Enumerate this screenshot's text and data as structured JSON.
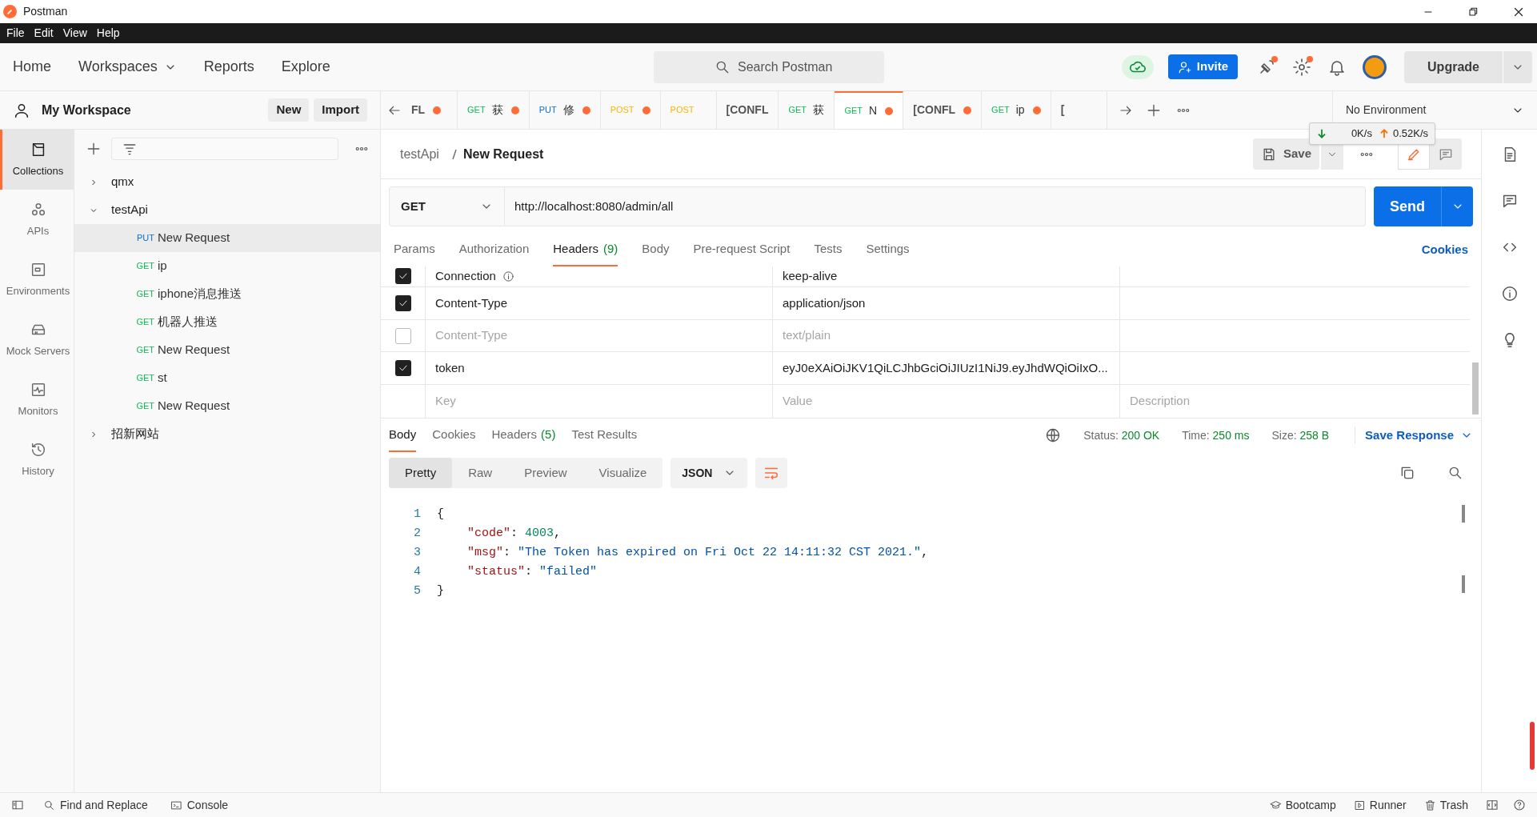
{
  "window": {
    "title": "Postman"
  },
  "menu": [
    "File",
    "Edit",
    "View",
    "Help"
  ],
  "nav": [
    "Home",
    "Workspaces",
    "Reports",
    "Explore"
  ],
  "search": {
    "placeholder": "Search Postman"
  },
  "invite": "Invite",
  "upgrade": "Upgrade",
  "workspace": {
    "title": "My Workspace",
    "buttons": [
      "New",
      "Import"
    ]
  },
  "sidebar": {
    "items": [
      {
        "label": "Collections",
        "selected": true
      },
      {
        "label": "APIs",
        "selected": false
      },
      {
        "label": "Environments",
        "selected": false
      },
      {
        "label": "Mock Servers",
        "selected": false
      },
      {
        "label": "Monitors",
        "selected": false
      },
      {
        "label": "History",
        "selected": false
      }
    ]
  },
  "collections": [
    {
      "name": "qmx",
      "expanded": false
    },
    {
      "name": "testApi",
      "expanded": true,
      "children": [
        {
          "method": "PUT",
          "color": "#0b70d8",
          "name": "New Request",
          "selected": true
        },
        {
          "method": "GET",
          "color": "#0cbb52",
          "name": "ip",
          "selected": false
        },
        {
          "method": "GET",
          "color": "#0cbb52",
          "name": "iphone消息推送",
          "selected": false
        },
        {
          "method": "GET",
          "color": "#0cbb52",
          "name": "机器人推送",
          "selected": false
        },
        {
          "method": "GET",
          "color": "#0cbb52",
          "name": "New Request",
          "selected": false
        },
        {
          "method": "GET",
          "color": "#0cbb52",
          "name": "st",
          "selected": false
        },
        {
          "method": "GET",
          "color": "#0cbb52",
          "name": "New Request",
          "selected": false
        }
      ]
    },
    {
      "name": "招新网站",
      "expanded": false
    }
  ],
  "tabs": [
    {
      "name": "FL",
      "unsaved": true,
      "selected": false
    },
    {
      "method": "GET",
      "color": "#0cbb52",
      "name": "获",
      "unsaved": true,
      "selected": false
    },
    {
      "method": "PUT",
      "color": "#0b70d8",
      "name": "修",
      "unsaved": true,
      "selected": false
    },
    {
      "method": "POST",
      "color": "#ffb400",
      "unsaved": true,
      "selected": false
    },
    {
      "method": "POST",
      "color": "#ffb400",
      "unsaved": false,
      "selected": false
    },
    {
      "name": "[CONFL",
      "unsaved": false,
      "selected": false
    },
    {
      "method": "GET",
      "color": "#0cbb52",
      "name": "获",
      "unsaved": false,
      "selected": false
    },
    {
      "method": "GET",
      "color": "#0cbb52",
      "name": "N",
      "unsaved": true,
      "selected": true
    },
    {
      "name": "[CONFL",
      "unsaved": true,
      "selected": false
    },
    {
      "method": "GET",
      "color": "#0cbb52",
      "name": "ip",
      "unsaved": true,
      "selected": false
    },
    {
      "name": "[",
      "unsaved": false,
      "selected": false
    }
  ],
  "environment": "No Environment",
  "network": {
    "down": "0K/s",
    "up": "0.52K/s"
  },
  "breadcrumb": {
    "parent": "testApi",
    "current": "New Request"
  },
  "save": "Save",
  "request": {
    "method": "GET",
    "url": "http://localhost:8080/admin/all",
    "send": "Send"
  },
  "request_tabs": [
    {
      "label": "Params",
      "selected": false
    },
    {
      "label": "Authorization",
      "selected": false
    },
    {
      "label": "Headers",
      "count": "(9)",
      "selected": true
    },
    {
      "label": "Body",
      "selected": false
    },
    {
      "label": "Pre-request Script",
      "selected": false
    },
    {
      "label": "Tests",
      "selected": false
    },
    {
      "label": "Settings",
      "selected": false
    }
  ],
  "cookies_link": "Cookies",
  "headers": [
    {
      "checked": true,
      "key": "Connection",
      "info": true,
      "value": "keep-alive"
    },
    {
      "checked": true,
      "key": "Content-Type",
      "value": "application/json"
    },
    {
      "checked": false,
      "key": "Content-Type",
      "value": "text/plain"
    },
    {
      "checked": true,
      "key": "token",
      "value": "eyJ0eXAiOiJKV1QiLCJhbGciOiJIUzI1NiJ9.eyJhdWQiOiIxO..."
    }
  ],
  "new_header": {
    "key": {
      "placeholder": "Key"
    },
    "value": {
      "placeholder": "Value"
    },
    "description": {
      "placeholder": "Description"
    }
  },
  "response_tabs": [
    {
      "label": "Body",
      "selected": true
    },
    {
      "label": "Cookies",
      "selected": false
    },
    {
      "label": "Headers",
      "count": "(5)",
      "selected": false
    },
    {
      "label": "Test Results",
      "selected": false
    }
  ],
  "response_status": [
    {
      "label": "Status:",
      "value": "200 OK"
    },
    {
      "label": "Time:",
      "value": "250 ms"
    },
    {
      "label": "Size:",
      "value": "258 B"
    }
  ],
  "save_response": "Save Response",
  "view_modes": [
    {
      "label": "Pretty",
      "selected": true
    },
    {
      "label": "Raw",
      "selected": false
    },
    {
      "label": "Preview",
      "selected": false
    },
    {
      "label": "Visualize",
      "selected": false
    }
  ],
  "format": "JSON",
  "code": [
    {
      "number": "1",
      "tokens": [
        {
          "kind": "punct",
          "text": "{"
        }
      ]
    },
    {
      "number": "2",
      "tokens": [
        {
          "kind": "key",
          "text": "\"code\""
        },
        {
          "kind": "punct",
          "text": ": "
        },
        {
          "kind": "number",
          "text": "4003"
        },
        {
          "kind": "punct",
          "text": ","
        }
      ]
    },
    {
      "number": "3",
      "tokens": [
        {
          "kind": "key",
          "text": "\"msg\""
        },
        {
          "kind": "punct",
          "text": ": "
        },
        {
          "kind": "string",
          "text": "\"The Token has expired on Fri Oct 22 14:11:32 CST 2021.\""
        },
        {
          "kind": "punct",
          "text": ","
        }
      ]
    },
    {
      "number": "4",
      "tokens": [
        {
          "kind": "key",
          "text": "\"status\""
        },
        {
          "kind": "punct",
          "text": ": "
        },
        {
          "kind": "string",
          "text": "\"failed\""
        }
      ]
    },
    {
      "number": "5",
      "tokens": [
        {
          "kind": "punct",
          "text": "}"
        }
      ]
    }
  ],
  "status_bar": {
    "left": [
      "Find and Replace",
      "Console"
    ],
    "right": [
      "Bootcamp",
      "Runner",
      "Trash"
    ]
  }
}
